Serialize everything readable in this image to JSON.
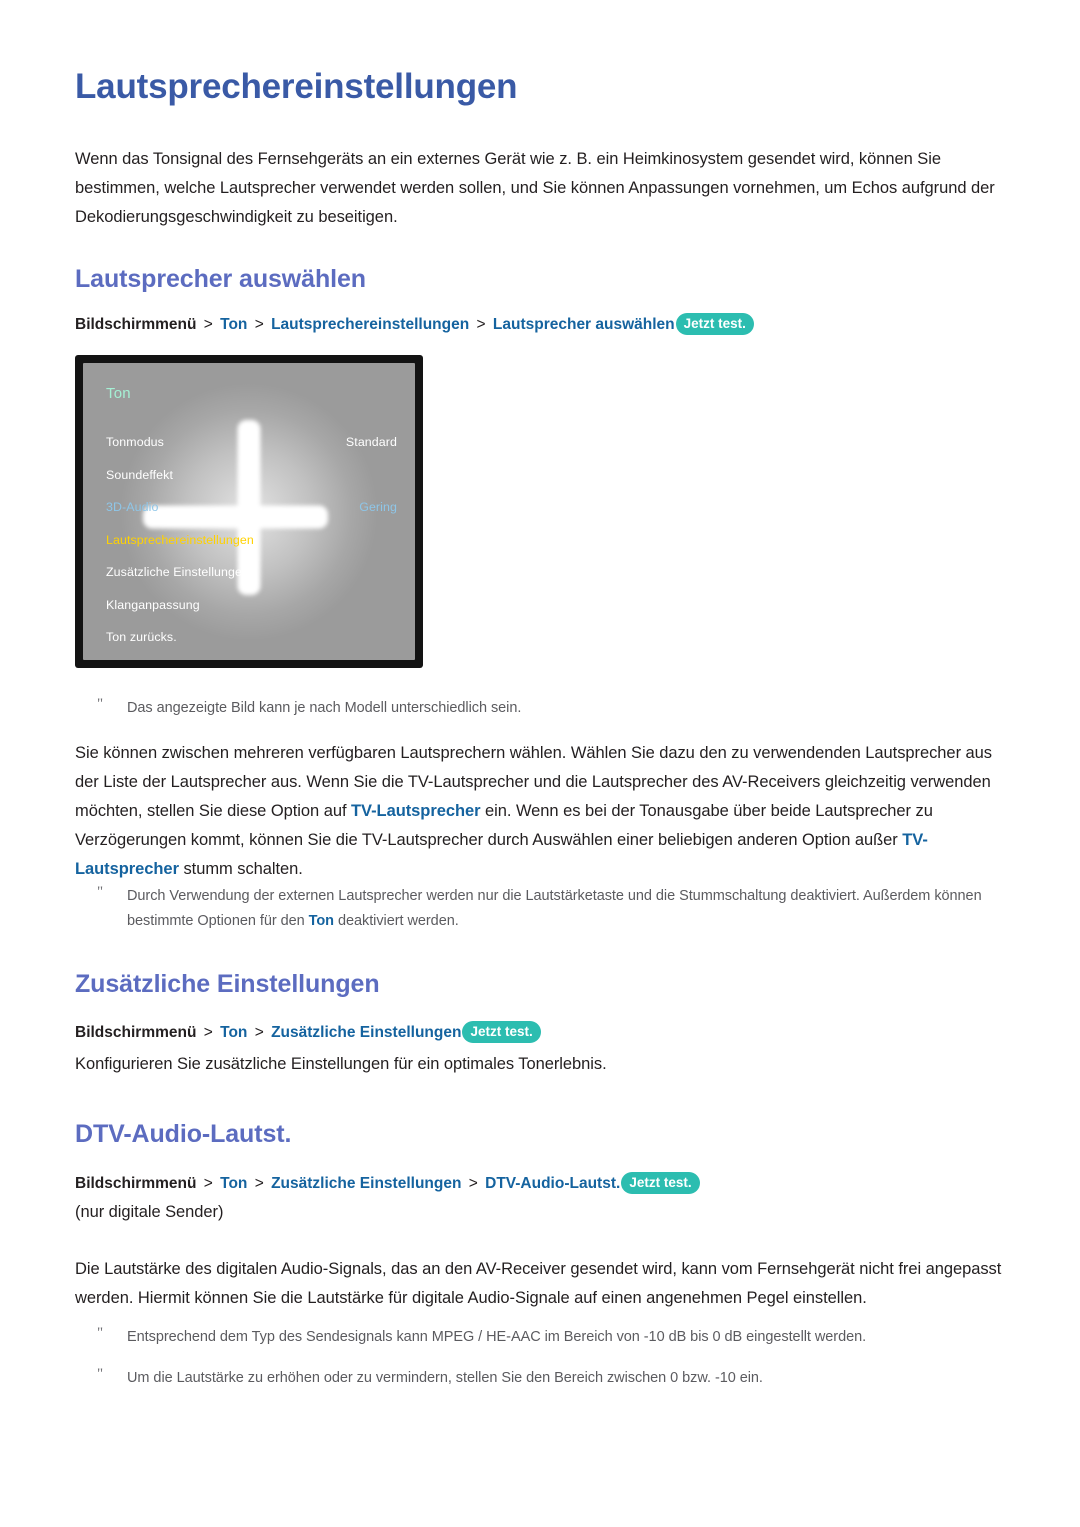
{
  "colors": {
    "title_blue": "#3a5aa6",
    "section_blue": "#5c6cc0",
    "link_blue": "#15639f",
    "badge_teal": "#2cbdb0",
    "menu_selected_yellow": "#ffd200",
    "menu_disabled_blue": "#8ec6e8",
    "menu_heading_mint": "#a5f0d4",
    "note_grey": "#5b5b5f"
  },
  "page_title": "Lautsprechereinstellungen",
  "intro_paragraph": "Wenn das Tonsignal des Fernsehgeräts an ein externes Gerät wie z. B. ein Heimkinosystem gesendet wird, können Sie bestimmen, welche Lautsprecher verwendet werden sollen, und Sie können Anpassungen vornehmen, um Echos aufgrund der Dekodierungsgeschwindigkeit zu beseitigen.",
  "sections": [
    {
      "id": "lautsprecher-auswaehlen",
      "title": "Lautsprecher auswählen",
      "breadcrumb": {
        "root": "Bildschirmmenü",
        "separator": ">",
        "crumbs": [
          "Ton",
          "Lautsprechereinstellungen",
          "Lautsprecher auswählen"
        ],
        "badge": "Jetzt test."
      },
      "figure_note": {
        "mark": "\"",
        "text": "Das angezeigte Bild kann je nach Modell unterschiedlich sein."
      },
      "body": {
        "part1": "Sie können zwischen mehreren verfügbaren Lautsprechern wählen. Wählen Sie dazu den zu verwendenden Lautsprecher aus der Liste der Lautsprecher aus. Wenn Sie die TV-Lautsprecher und die Lautsprecher des AV-Receivers gleichzeitig verwenden möchten, stellen Sie diese Option auf ",
        "hl1": "TV-Lautsprecher",
        "part2": " ein. Wenn es bei der Tonausgabe über beide Lautsprecher zu Verzögerungen kommt, können Sie die TV-Lautsprecher durch Auswählen einer beliebigen anderen Option außer ",
        "hl2": "TV-Lautsprecher",
        "part3": " stumm schalten."
      },
      "note": {
        "mark": "\"",
        "part1": "Durch Verwendung der externen Lautsprecher werden nur die Lautstärketaste und die Stummschaltung deaktiviert. Außerdem können bestimmte Optionen für den ",
        "hl1": "Ton",
        "part2": " deaktiviert werden."
      }
    },
    {
      "id": "zusaetzliche-einstellungen",
      "title": "Zusätzliche Einstellungen",
      "breadcrumb": {
        "root": "Bildschirmmenü",
        "separator": ">",
        "crumbs": [
          "Ton",
          "Zusätzliche Einstellungen"
        ],
        "badge": "Jetzt test."
      },
      "body": "Konfigurieren Sie zusätzliche Einstellungen für ein optimales Tonerlebnis."
    },
    {
      "id": "dtv-audio-lautst",
      "title": "DTV-Audio-Lautst.",
      "breadcrumb": {
        "root": "Bildschirmmenü",
        "separator": ">",
        "crumbs": [
          "Ton",
          "Zusätzliche Einstellungen",
          "DTV-Audio-Lautst."
        ],
        "badge": "Jetzt test."
      },
      "subnote": "(nur digitale Sender)",
      "body": "Die Lautstärke des digitalen Audio-Signals, das an den AV-Receiver gesendet wird, kann vom Fernsehgerät nicht frei angepasst werden. Hiermit können Sie die Lautstärke für digitale Audio-Signale auf einen angenehmen Pegel einstellen.",
      "notes": [
        {
          "mark": "\"",
          "text": "Entsprechend dem Typ des Sendesignals kann MPEG / HE-AAC im Bereich von -10 dB bis 0 dB eingestellt werden."
        },
        {
          "mark": "\"",
          "text": "Um die Lautstärke zu erhöhen oder zu vermindern, stellen Sie den Bereich zwischen 0 bzw. -10 ein."
        }
      ]
    }
  ],
  "tv_menu": {
    "heading": "Ton",
    "rows": [
      {
        "label": "Tonmodus",
        "value": "Standard",
        "state": "normal"
      },
      {
        "label": "Soundeffekt",
        "value": "",
        "state": "normal"
      },
      {
        "label": "3D-Audio",
        "value": "Gering",
        "state": "disabled"
      },
      {
        "label": "Lautsprechereinstellungen",
        "value": "",
        "state": "selected"
      },
      {
        "label": "Zusätzliche Einstellungen",
        "value": "",
        "state": "clipped"
      },
      {
        "label": "Klanganpassung",
        "value": "",
        "state": "normal"
      },
      {
        "label": "Ton zurücks.",
        "value": "",
        "state": "normal"
      }
    ]
  }
}
